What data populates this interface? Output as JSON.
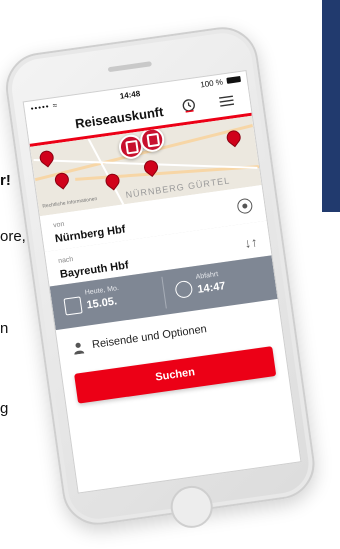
{
  "background": {
    "snippets": [
      "r!",
      "ore,",
      "n",
      "g"
    ],
    "accent_block_color": "#213a6e"
  },
  "status_bar": {
    "signal": "••••• ≈",
    "time": "14:48",
    "battery": "100 %"
  },
  "header": {
    "title": "Reiseauskunft",
    "icons": [
      "clock-icon",
      "menu-icon"
    ]
  },
  "map": {
    "street_label": "NÜRNBERG GÜRTEL",
    "attribution": "Rechtliche Informationen"
  },
  "from": {
    "label": "von",
    "value": "Nürnberg Hbf"
  },
  "to": {
    "label": "nach",
    "value": "Bayreuth Hbf"
  },
  "date": {
    "label": "Heute, Mo.",
    "value": "15.05."
  },
  "departure": {
    "label": "Abfahrt",
    "value": "14:47"
  },
  "options": {
    "label": "Reisende und Optionen"
  },
  "search_button": {
    "label": "Suchen"
  },
  "colors": {
    "brand_red": "#ec0016",
    "datetime_bar": "#7f8794"
  }
}
